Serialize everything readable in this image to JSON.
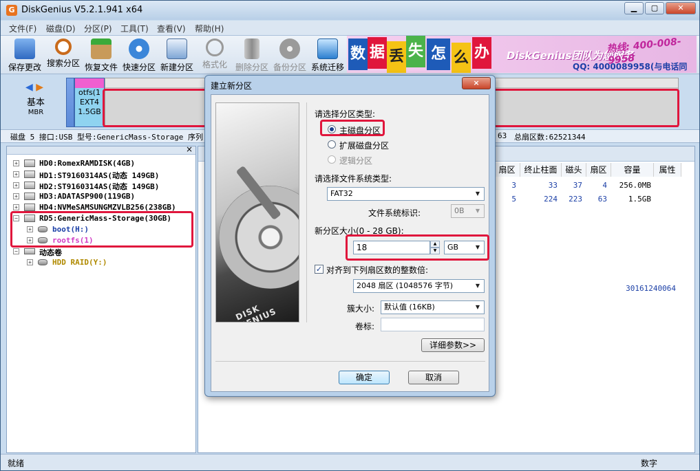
{
  "app": {
    "title": "DiskGenius V5.2.1.941 x64",
    "icon": "G"
  },
  "menu": [
    "文件(F)",
    "磁盘(D)",
    "分区(P)",
    "工具(T)",
    "查看(V)",
    "帮助(H)"
  ],
  "toolbar": [
    {
      "label": "保存更改",
      "icon": "save-icon",
      "enabled": true
    },
    {
      "label": "搜索分区",
      "icon": "magnifier-icon",
      "enabled": true
    },
    {
      "label": "恢复文件",
      "icon": "recover-box-icon",
      "enabled": true
    },
    {
      "label": "快速分区",
      "icon": "quick-partition-icon",
      "enabled": true
    },
    {
      "label": "新建分区",
      "icon": "new-partition-icon",
      "enabled": true
    },
    {
      "label": "格式化",
      "icon": "format-icon",
      "enabled": false
    },
    {
      "label": "删除分区",
      "icon": "trash-icon",
      "enabled": false
    },
    {
      "label": "备份分区",
      "icon": "backup-disc-icon",
      "enabled": false
    },
    {
      "label": "系统迁移",
      "icon": "migration-icon",
      "enabled": true
    }
  ],
  "banner": {
    "chars": [
      "数",
      "据",
      "丢",
      "失",
      "怎",
      "么",
      "办"
    ],
    "title": "DiskGenius团队为您服务",
    "phone": "400-008-9958",
    "phone_label": "热线:",
    "qq": "QQ: 4000089958(与电话同号)"
  },
  "disk_map": {
    "label": "基本",
    "sublabel": "MBR",
    "rootfs_lines": [
      "otfs(1",
      "EXT4",
      "1.5GB"
    ]
  },
  "info_line": {
    "left": "磁盘 5 接口:USB  型号:GenericMass-Storage  序列",
    "right_a": "63",
    "right_b": "总扇区数:62521344"
  },
  "tree": [
    {
      "label": "HD0:RomexRAMDISK(4GB)"
    },
    {
      "label": "HD1:ST9160314AS(动态 149GB)"
    },
    {
      "label": "HD2:ST9160314AS(动态 149GB)"
    },
    {
      "label": "HD3:ADATASP900(119GB)"
    },
    {
      "label": "HD4:NVMeSAMSUNGMZVLB256(238GB)"
    },
    {
      "label": "RD5:GenericMass-Storage(30GB)"
    },
    {
      "label": "boot(H:)"
    },
    {
      "label": "rootfs(1)"
    },
    {
      "label": "动态卷"
    },
    {
      "label": "HDD RAID(Y:)"
    }
  ],
  "table": {
    "columns": [
      "扇区",
      "终止柱面",
      "磁头",
      "扇区",
      "容量",
      "属性"
    ],
    "rows": [
      [
        "3",
        "33",
        "37",
        "4",
        "256.0MB",
        ""
      ],
      [
        "5",
        "224",
        "223",
        "63",
        "1.5GB",
        ""
      ]
    ],
    "extra_value": "30161240064"
  },
  "status": {
    "left": "就绪",
    "right": "数字"
  },
  "dialog": {
    "title": "建立新分区",
    "close": "×",
    "art_text": "DISK GENIUS",
    "type_label": "请选择分区类型:",
    "type_options": [
      {
        "label": "主磁盘分区",
        "selected": true,
        "enabled": true
      },
      {
        "label": "扩展磁盘分区",
        "selected": false,
        "enabled": true
      },
      {
        "label": "逻辑分区",
        "selected": false,
        "enabled": false
      }
    ],
    "fs_label": "请选择文件系统类型:",
    "fs_value": "FAT32",
    "fs_id_label": "文件系统标识:",
    "fs_id_value": "0B",
    "size_label": "新分区大小(0 - 28 GB):",
    "size_value": "18",
    "size_unit": "GB",
    "align_label": "对齐到下列扇区数的整数倍:",
    "align_checked": true,
    "align_value": "2048 扇区 (1048576 字节)",
    "cluster_label": "簇大小:",
    "cluster_value": "默认值 (16KB)",
    "volume_label": "卷标:",
    "volume_value": "",
    "details_button": "详细参数>>",
    "ok_button": "确定",
    "cancel_button": "取消"
  },
  "colors": {
    "highlight": "#e0163c",
    "accent": "#1b3fa6",
    "rootfs_pink": "#f05fd0",
    "rootfs_blue": "#8fd3f0"
  }
}
